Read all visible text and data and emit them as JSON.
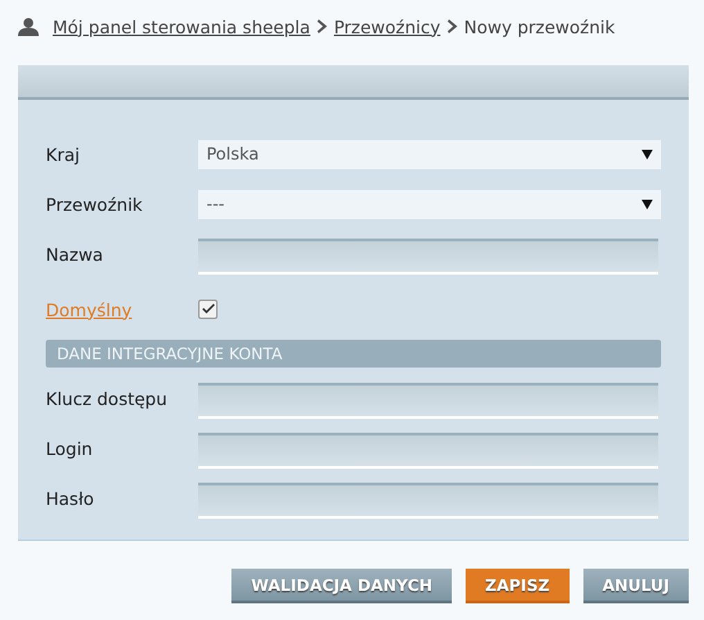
{
  "breadcrumb": [
    {
      "label": "Mój panel sterowania sheepla",
      "kind": "link"
    },
    {
      "label": "Przewoźnicy",
      "kind": "link"
    },
    {
      "label": "Nowy przewoźnik",
      "kind": "current"
    }
  ],
  "form": {
    "rows": [
      {
        "kind": "select",
        "label": "Kraj",
        "value": "Polska"
      },
      {
        "kind": "select",
        "label": "Przewoźnik",
        "value": "---"
      },
      {
        "kind": "text",
        "label": "Nazwa"
      },
      {
        "kind": "checkbox",
        "label": "Domyślny",
        "checked": true
      },
      {
        "kind": "section",
        "label": "DANE INTEGRACYJNE KONTA"
      },
      {
        "kind": "text",
        "label": "Klucz dostępu"
      },
      {
        "kind": "text",
        "label": "Login"
      },
      {
        "kind": "text",
        "label": "Hasło"
      }
    ]
  },
  "buttons": [
    {
      "label": "WALIDACJA DANYCH",
      "kind": "secondary"
    },
    {
      "label": "ZAPISZ",
      "kind": "primary"
    },
    {
      "label": "ANULUJ",
      "kind": "secondary"
    }
  ]
}
